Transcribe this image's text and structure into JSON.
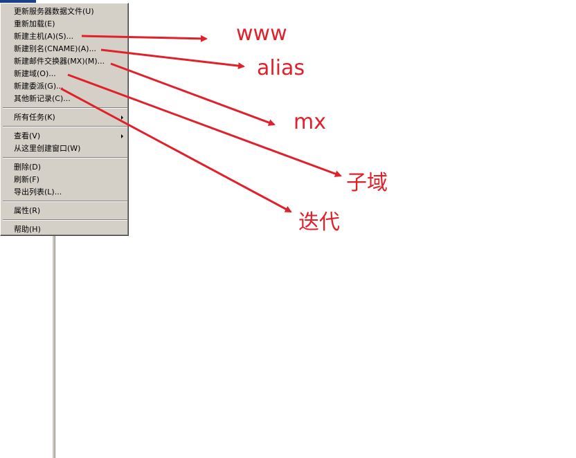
{
  "menu": {
    "items": [
      {
        "label": "更新服务器数据文件(U)"
      },
      {
        "label": "重新加载(E)"
      },
      {
        "label": "新建主机(A)(S)..."
      },
      {
        "label": "新建别名(CNAME)(A)..."
      },
      {
        "label": "新建邮件交换器(MX)(M)..."
      },
      {
        "label": "新建域(O)..."
      },
      {
        "label": "新建委派(G)..."
      },
      {
        "label": "其他新记录(C)..."
      },
      {
        "label": "所有任务(K)",
        "submenu": true
      },
      {
        "label": "查看(V)",
        "submenu": true
      },
      {
        "label": "从这里创建窗口(W)"
      },
      {
        "label": "删除(D)"
      },
      {
        "label": "刷新(F)"
      },
      {
        "label": "导出列表(L)..."
      },
      {
        "label": "属性(R)"
      },
      {
        "label": "帮助(H)"
      }
    ]
  },
  "annotations": {
    "color": "#e0202a",
    "labels": [
      "www",
      "alias",
      "mx",
      "子域",
      "迭代"
    ]
  }
}
